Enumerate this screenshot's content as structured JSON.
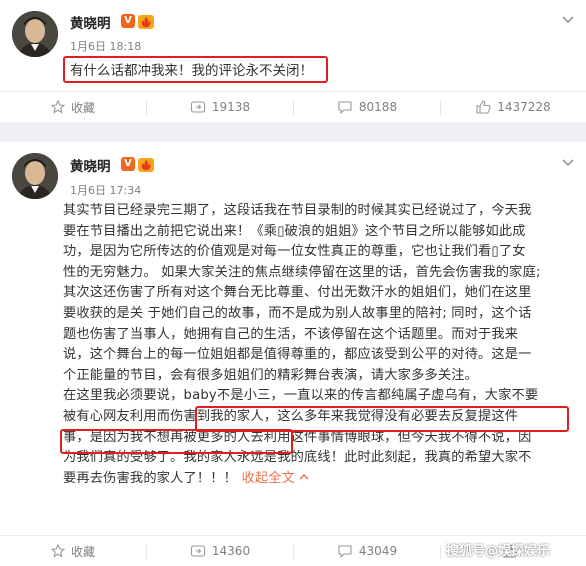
{
  "posts": [
    {
      "author": "黄晓明",
      "verified_badge": "V",
      "level_badge_icon": "flame-level-icon",
      "time": "1月6日 18:18",
      "text": "有什么话都冲我来！我的评论永不关闭！",
      "actions": {
        "collect": "收藏",
        "repost": "19138",
        "comment": "80188",
        "like": "1437228"
      }
    },
    {
      "author": "黄晓明",
      "verified_badge": "V",
      "level_badge_icon": "flame-level-icon",
      "time": "1月6日 17:34",
      "text_lines": [
        "其实节目已经录完三期了，这段话我在节目录制的时候其实已经说过了，今天我",
        "要在节目播出之前把它说出来！《乘",
        "破浪的姐姐》这个节目之所以能够如此成",
        "功，是因为它所传达的价值观是对每一位女性真正的尊重，它也让我们看",
        "了女",
        "性的无穷魅力。 如果大家关注的焦点继续停留在这里的话，首先会伤害我的家庭;",
        "其次这还伤害了所有对这个舞台无比尊重、付出无数汗水的姐姐们，她们在这里",
        "要收获的是关 于她们自己的故事，而不是成为别人故事里的陪衬; 同时，这个话",
        "题也伤害了当事人，她拥有自己的生活，不该停留在这个话题里。而对于我来",
        "说，这个舞台上的每一位姐姐都是值得尊重的，都应该受到公平的对待。这是一",
        "个正能量的节目，会有很多姐姐们的精彩舞台表演，请大家多多关注。",
        "在这里我必须要说，",
        "baby不是小三，一直以来的传言都纯属子虚乌有，大家不要",
        "被有心网友利用而伤害到我的家人",
        "，这么多年来我觉得没有必要去反复提这件",
        "事，是因为我不想再被更多的人去利用这件事情博眼球，但今天我不得不说，因",
        "为我们真的受够了。我的家人永远是我的底线！此时此刻起，我真的希望大家不",
        "要再去伤害我的家人了！！！ "
      ],
      "collapse_link": "收起全文",
      "actions": {
        "collect": "收藏",
        "repost": "14360",
        "comment": "43049",
        "like": ""
      }
    }
  ],
  "watermark": "搜狐号@娱探娱乐"
}
